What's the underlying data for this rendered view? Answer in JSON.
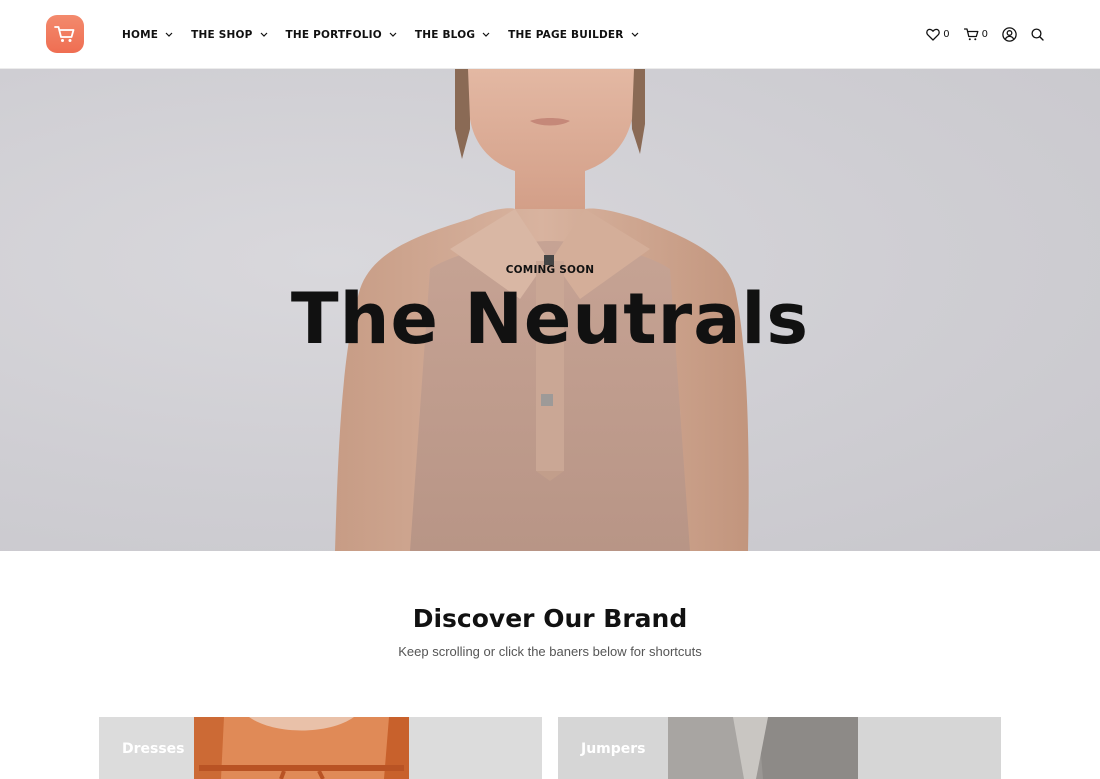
{
  "header": {
    "logo_icon": "cart-icon",
    "accent_color": "#ef6e52",
    "nav": [
      {
        "label": "HOME"
      },
      {
        "label": "THE SHOP"
      },
      {
        "label": "THE PORTFOLIO"
      },
      {
        "label": "THE BLOG"
      },
      {
        "label": "THE PAGE BUILDER"
      }
    ],
    "wishlist_count": "0",
    "cart_count": "0",
    "tool_icons": [
      "heart-icon",
      "cart-icon",
      "account-icon",
      "search-icon"
    ]
  },
  "hero": {
    "kicker": "COMING SOON",
    "title": "The Neutrals"
  },
  "brand": {
    "title": "Discover Our Brand",
    "subtitle": "Keep scrolling or click the baners below for shortcuts"
  },
  "banners": [
    {
      "label": "Dresses"
    },
    {
      "label": "Jumpers"
    }
  ]
}
